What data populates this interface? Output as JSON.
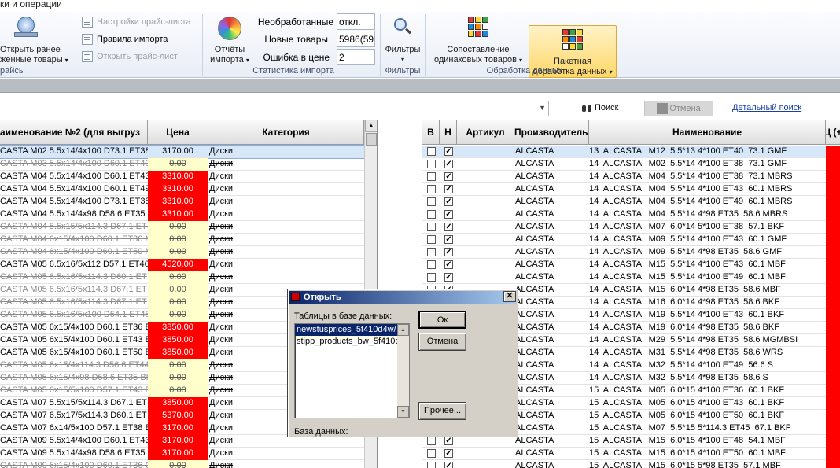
{
  "window": {
    "title_fragment": "ки и операции"
  },
  "ribbon": {
    "import_prev": {
      "line1": "Открыть ранее",
      "line2": "женные товары",
      "group": "райсы"
    },
    "price_settings": "Настройки прайс-листа",
    "import_rules": "Правила импорта",
    "open_price": "Открыть прайс-лист",
    "reports": {
      "line1": "Отчёты",
      "line2": "импорта"
    },
    "stats": {
      "unprocessed_label": "Необработанные",
      "unprocessed_value": "откл.",
      "new_label": "Новые товары",
      "new_value": "5986(598",
      "price_err_label": "Ошибка в цене",
      "price_err_value": "2",
      "group": "Статистика импорта"
    },
    "filters": {
      "label": "Фильтры",
      "group": "Фильтры"
    },
    "compare": {
      "line1": "Сопоставление",
      "line2": "одинаковых товаров"
    },
    "batch": {
      "line1": "Пакетная",
      "line2": "обработка данных"
    },
    "processing_group": "Обработка данных",
    "colors": {
      "batch_bg": "#ffd86a",
      "accent": "#0a246a"
    }
  },
  "search": {
    "search_label": "Поиск",
    "cancel_label": "Отмена",
    "advanced_label": "Детальный поиск"
  },
  "left_grid": {
    "headers": {
      "name": "аименование №2 (для выгруз",
      "price": "Цена",
      "category": "Категория"
    },
    "rows": [
      {
        "name": "CASTA M02 5.5x14/4x100 D73.1 ET38",
        "price": "3170.00",
        "style": "normal",
        "cat": "Диски",
        "strike": false,
        "sel": true
      },
      {
        "name": "CASTA M03 5.5x14/4x100 D60.1 ET49",
        "price": "0.00",
        "style": "yellow",
        "cat": "Диски",
        "strike": true,
        "sel": false
      },
      {
        "name": "CASTA M04 5.5x14/4x100 D60.1 ET43",
        "price": "3310.00",
        "style": "red",
        "cat": "Диски",
        "strike": false,
        "sel": false
      },
      {
        "name": "CASTA M04 5.5x14/4x100 D60.1 ET49",
        "price": "3310.00",
        "style": "red",
        "cat": "Диски",
        "strike": false,
        "sel": false
      },
      {
        "name": "CASTA M04 5.5x14/4x100 D73.1 ET38",
        "price": "3310.00",
        "style": "red",
        "cat": "Диски",
        "strike": false,
        "sel": false
      },
      {
        "name": "CASTA M04 5.5x14/4x98 D58.6 ET35 M",
        "price": "3310.00",
        "style": "red",
        "cat": "Диски",
        "strike": false,
        "sel": false
      },
      {
        "name": "CASTA M04 5.5x15/5x114.3 D67.1 ET4",
        "price": "0.00",
        "style": "yellow",
        "cat": "Диски",
        "strike": true,
        "sel": false
      },
      {
        "name": "CASTA M04 6x15/4x100 D60.1 ET36 MI",
        "price": "0.00",
        "style": "yellow",
        "cat": "Диски",
        "strike": true,
        "sel": false
      },
      {
        "name": "CASTA M04 6x15/4x100 D60.1 ET50 MI",
        "price": "0.00",
        "style": "yellow",
        "cat": "Диски",
        "strike": true,
        "sel": false
      },
      {
        "name": "CASTA M05 6.5x16/5x112 D57.1 ET46",
        "price": "4520.00",
        "style": "red",
        "cat": "Диски",
        "strike": false,
        "sel": false
      },
      {
        "name": "CASTA M05 6.5x16/5x114.3 D60.1 ET",
        "price": "0.00",
        "style": "yellow",
        "cat": "Диски",
        "strike": true,
        "sel": false
      },
      {
        "name": "CASTA M05 6.5x16/5x114.3 D67.1 ET",
        "price": "0.00",
        "style": "yellow",
        "cat": "Диски",
        "strike": true,
        "sel": false
      },
      {
        "name": "CASTA M05 6.5x16/5x114.3 D67.1 ET",
        "price": "0.00",
        "style": "yellow",
        "cat": "Диски",
        "strike": true,
        "sel": false
      },
      {
        "name": "CASTA M05 6.5x16/5x100 D54.1 ET48",
        "price": "0.00",
        "style": "yellow",
        "cat": "Диски",
        "strike": true,
        "sel": false
      },
      {
        "name": "CASTA M05 6x15/4x100 D60.1 ET36 BK",
        "price": "3850.00",
        "style": "red",
        "cat": "Диски",
        "strike": false,
        "sel": false
      },
      {
        "name": "CASTA M05 6x15/4x100 D60.1 ET43 BK",
        "price": "3850.00",
        "style": "red",
        "cat": "Диски",
        "strike": false,
        "sel": false
      },
      {
        "name": "CASTA M05 6x15/4x100 D60.1 ET50 BK",
        "price": "3850.00",
        "style": "red",
        "cat": "Диски",
        "strike": false,
        "sel": false
      },
      {
        "name": "CASTA M05 6x15/4x114.3 D56.6 ET44",
        "price": "0.00",
        "style": "yellow",
        "cat": "Диски",
        "strike": true,
        "sel": false
      },
      {
        "name": "CASTA M05 6x15/4x98 D58.6 ET35 BKF",
        "price": "0.00",
        "style": "yellow",
        "cat": "Диски",
        "strike": true,
        "sel": false
      },
      {
        "name": "CASTA M05 6x15/5x100 D57.1 ET43 BK",
        "price": "0.00",
        "style": "yellow",
        "cat": "Диски",
        "strike": true,
        "sel": false
      },
      {
        "name": "CASTA M07 5.5x15/5x114.3 D67.1 ET",
        "price": "3850.00",
        "style": "red",
        "cat": "Диски",
        "strike": false,
        "sel": false
      },
      {
        "name": "CASTA M07 6.5x17/5x114.3 D60.1 ET",
        "price": "5370.00",
        "style": "red",
        "cat": "Диски",
        "strike": false,
        "sel": false
      },
      {
        "name": "CASTA M07 6x14/5x100 D57.1 ET38 BK",
        "price": "3170.00",
        "style": "red",
        "cat": "Диски",
        "strike": false,
        "sel": false
      },
      {
        "name": "CASTA M09 5.5x14/4x100 D60.1 ET43",
        "price": "3170.00",
        "style": "red",
        "cat": "Диски",
        "strike": false,
        "sel": false
      },
      {
        "name": "CASTA M09 5.5x14/4x98 D58.6 ET35 G",
        "price": "3170.00",
        "style": "red",
        "cat": "Диски",
        "strike": false,
        "sel": false
      },
      {
        "name": "CASTA M09 6x15/4x100 D60.1 ET36 G",
        "price": "0.00",
        "style": "yellow",
        "cat": "Диски",
        "strike": true,
        "sel": false
      }
    ]
  },
  "right_grid": {
    "headers": {
      "b": "В",
      "h": "Н",
      "article": "Артикул",
      "maker": "Производитель",
      "name": "Наименование",
      "price": "Ц (+"
    },
    "rows": [
      {
        "brand": "ALCASTA",
        "name": "13  ALCASTA   M12  5.5*13 4*100 ET40  73.1 GMF",
        "checked": true,
        "sel": true
      },
      {
        "brand": "ALCASTA",
        "name": "14  ALCASTA   M02  5.5*14 4*100 ET38  73.1 GMF",
        "checked": true,
        "sel": false
      },
      {
        "brand": "ALCASTA",
        "name": "14  ALCASTA   M04  5.5*14 4*100 ET38  73.1 MBRS",
        "checked": true,
        "sel": false
      },
      {
        "brand": "ALCASTA",
        "name": "14  ALCASTA   M04  5.5*14 4*100 ET43  60.1 MBRS",
        "checked": true,
        "sel": false
      },
      {
        "brand": "ALCASTA",
        "name": "14  ALCASTA   M04  5.5*14 4*100 ET49  60.1 MBRS",
        "checked": true,
        "sel": false
      },
      {
        "brand": "ALCASTA",
        "name": "14  ALCASTA   M04  5.5*14 4*98 ET35  58.6 MBRS",
        "checked": true,
        "sel": false
      },
      {
        "brand": "ALCASTA",
        "name": "14  ALCASTA   M07  6.0*14 5*100 ET38  57.1 BKF",
        "checked": true,
        "sel": false
      },
      {
        "brand": "ALCASTA",
        "name": "14  ALCASTA   M09  5.5*14 4*100 ET43  60.1 GMF",
        "checked": true,
        "sel": false
      },
      {
        "brand": "ALCASTA",
        "name": "14  ALCASTA   M09  5.5*14 4*98 ET35  58.6 GMF",
        "checked": true,
        "sel": false
      },
      {
        "brand": "ALCASTA",
        "name": "14  ALCASTA   M15  5.5*14 4*100 ET43  60.1 MBF",
        "checked": true,
        "sel": false
      },
      {
        "brand": "ALCASTA",
        "name": "14  ALCASTA   M15  5.5*14 4*100 ET49  60.1 MBF",
        "checked": true,
        "sel": false
      },
      {
        "brand": "ALCASTA",
        "name": "14  ALCASTA   M15  6.0*14 4*98 ET35  58.6 MBF",
        "checked": true,
        "sel": false
      },
      {
        "brand": "ALCASTA",
        "name": "14  ALCASTA   M16  6.0*14 4*98 ET35  58.6 BKF",
        "checked": true,
        "sel": false
      },
      {
        "brand": "ALCASTA",
        "name": "14  ALCASTA   M19  5.5*14 4*100 ET43  60.1 BKF",
        "checked": true,
        "sel": false
      },
      {
        "brand": "ALCASTA",
        "name": "14  ALCASTA   M19  6.0*14 4*98 ET35  58.6 BKF",
        "checked": true,
        "sel": false
      },
      {
        "brand": "ALCASTA",
        "name": "14  ALCASTA   M29  5.5*14 4*98 ET35  58.6 MGMBSI",
        "checked": true,
        "sel": false
      },
      {
        "brand": "ALCASTA",
        "name": "14  ALCASTA   M31  5.5*14 4*98 ET35  58.6 WRS",
        "checked": true,
        "sel": false
      },
      {
        "brand": "ALCASTA",
        "name": "14  ALCASTA   M32  5.5*14 4*100 ET49  56.6 S",
        "checked": true,
        "sel": false
      },
      {
        "brand": "ALCASTA",
        "name": "14  ALCASTA   M32  5.5*14 4*98 ET35  58.6 S",
        "checked": true,
        "sel": false
      },
      {
        "brand": "ALCASTA",
        "name": "15  ALCASTA   M05  6.0*15 4*100 ET36  60.1 BKF",
        "checked": true,
        "sel": false
      },
      {
        "brand": "ALCASTA",
        "name": "15  ALCASTA   M05  6.0*15 4*100 ET43  60.1 BKF",
        "checked": true,
        "sel": false
      },
      {
        "brand": "ALCASTA",
        "name": "15  ALCASTA   M05  6.0*15 4*100 ET50  60.1 BKF",
        "checked": true,
        "sel": false
      },
      {
        "brand": "ALCASTA",
        "name": "15  ALCASTA   M07  5.5*15 5*114.3 ET45  67.1 BKF",
        "checked": true,
        "sel": false
      },
      {
        "brand": "ALCASTA",
        "name": "15  ALCASTA   M15  6.0*15 4*100 ET48  54.1 MBF",
        "checked": true,
        "sel": false
      },
      {
        "brand": "ALCASTA",
        "name": "15  ALCASTA   M15  6.0*15 4*100 ET50  60.1 MBF",
        "checked": true,
        "sel": false
      },
      {
        "brand": "ALCASTA",
        "name": "15  ALCASTA   M15  6.0*15 5*98 ET35  57.1 MBF",
        "checked": true,
        "sel": false
      }
    ]
  },
  "dialog": {
    "title": "Открыть",
    "tables_label": "Таблицы в базе данных:",
    "items": [
      "newstusprices_5f410d4w/…",
      "stipp_products_bw_5f410c"
    ],
    "ok": "Ок",
    "cancel": "Отмена",
    "browse": "Прочее...",
    "db_label": "База данных:"
  }
}
